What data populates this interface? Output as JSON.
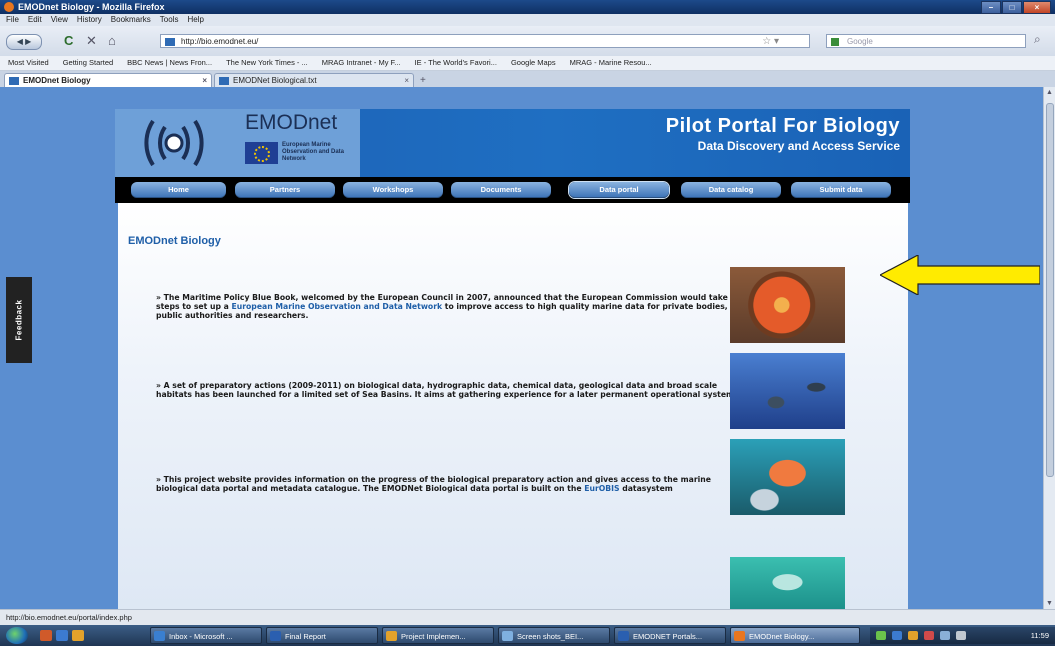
{
  "window": {
    "title": "EMODnet Biology - Mozilla Firefox",
    "controls": [
      "–",
      "□",
      "×"
    ]
  },
  "menu": [
    "File",
    "Edit",
    "View",
    "History",
    "Bookmarks",
    "Tools",
    "Help"
  ],
  "toolbar": {
    "back": "◀ ▶",
    "reload": "C",
    "stop": "✕",
    "home": "⌂",
    "url": "http://bio.emodnet.eu/",
    "search_placeholder": "Google"
  },
  "bookmarks": [
    "Most Visited",
    "Getting Started",
    "BBC News | News Fron...",
    "The New York Times - ...",
    "MRAG Intranet - My F...",
    "IE - The World's Favori...",
    "Google Maps",
    "MRAG - Marine Resou..."
  ],
  "tabs": [
    {
      "label": "EMODnet Biology",
      "active": true
    },
    {
      "label": "EMODNet Biological.txt",
      "active": false
    }
  ],
  "feedback_label": "Feedback",
  "site": {
    "brand": "EMODnet",
    "brand_sub": "European Marine Observation and Data Network",
    "title": "Pilot Portal For Biology",
    "subtitle": "Data Discovery and Access Service",
    "nav": [
      "Home",
      "Partners",
      "Workshops",
      "Documents",
      "Data portal",
      "Data catalog",
      "Submit data"
    ],
    "active_nav": "Data portal",
    "page_title": "EMODnet Biology",
    "paragraphs": [
      {
        "pre": "» The Maritime Policy Blue Book, welcomed by the European Council in 2007, announced that the European Commission would take steps to set up a ",
        "link": "European Marine Observation and Data Network",
        "post": " to improve access to high quality marine data for private bodies, public authorities and researchers."
      },
      {
        "pre": "» A set of preparatory actions (2009-2011) on biological data, hydrographic data, chemical data, geological data and broad scale habitats has been launched for a limited set of Sea Basins. It aims at gathering experience for a later permanent operational system.",
        "link": "",
        "post": ""
      },
      {
        "pre": "» This project website provides information on the progress of the biological preparatory action and gives access to the marine biological data portal and metadata catalogue. The EMODNet Biological data portal is built on the ",
        "link": "EurOBIS",
        "post": " datasystem"
      }
    ]
  },
  "annotation": {
    "color": "#ffeb00"
  },
  "status_text": "http://bio.emodnet.eu/portal/index.php",
  "taskbar": {
    "items": [
      "Inbox - Microsoft ...",
      "Final Report",
      "Project Implemen...",
      "Screen shots_BEI...",
      "EMODNET Portals...",
      "EMODnet Biology..."
    ],
    "active": "EMODnet Biology...",
    "clock": "11:59"
  }
}
